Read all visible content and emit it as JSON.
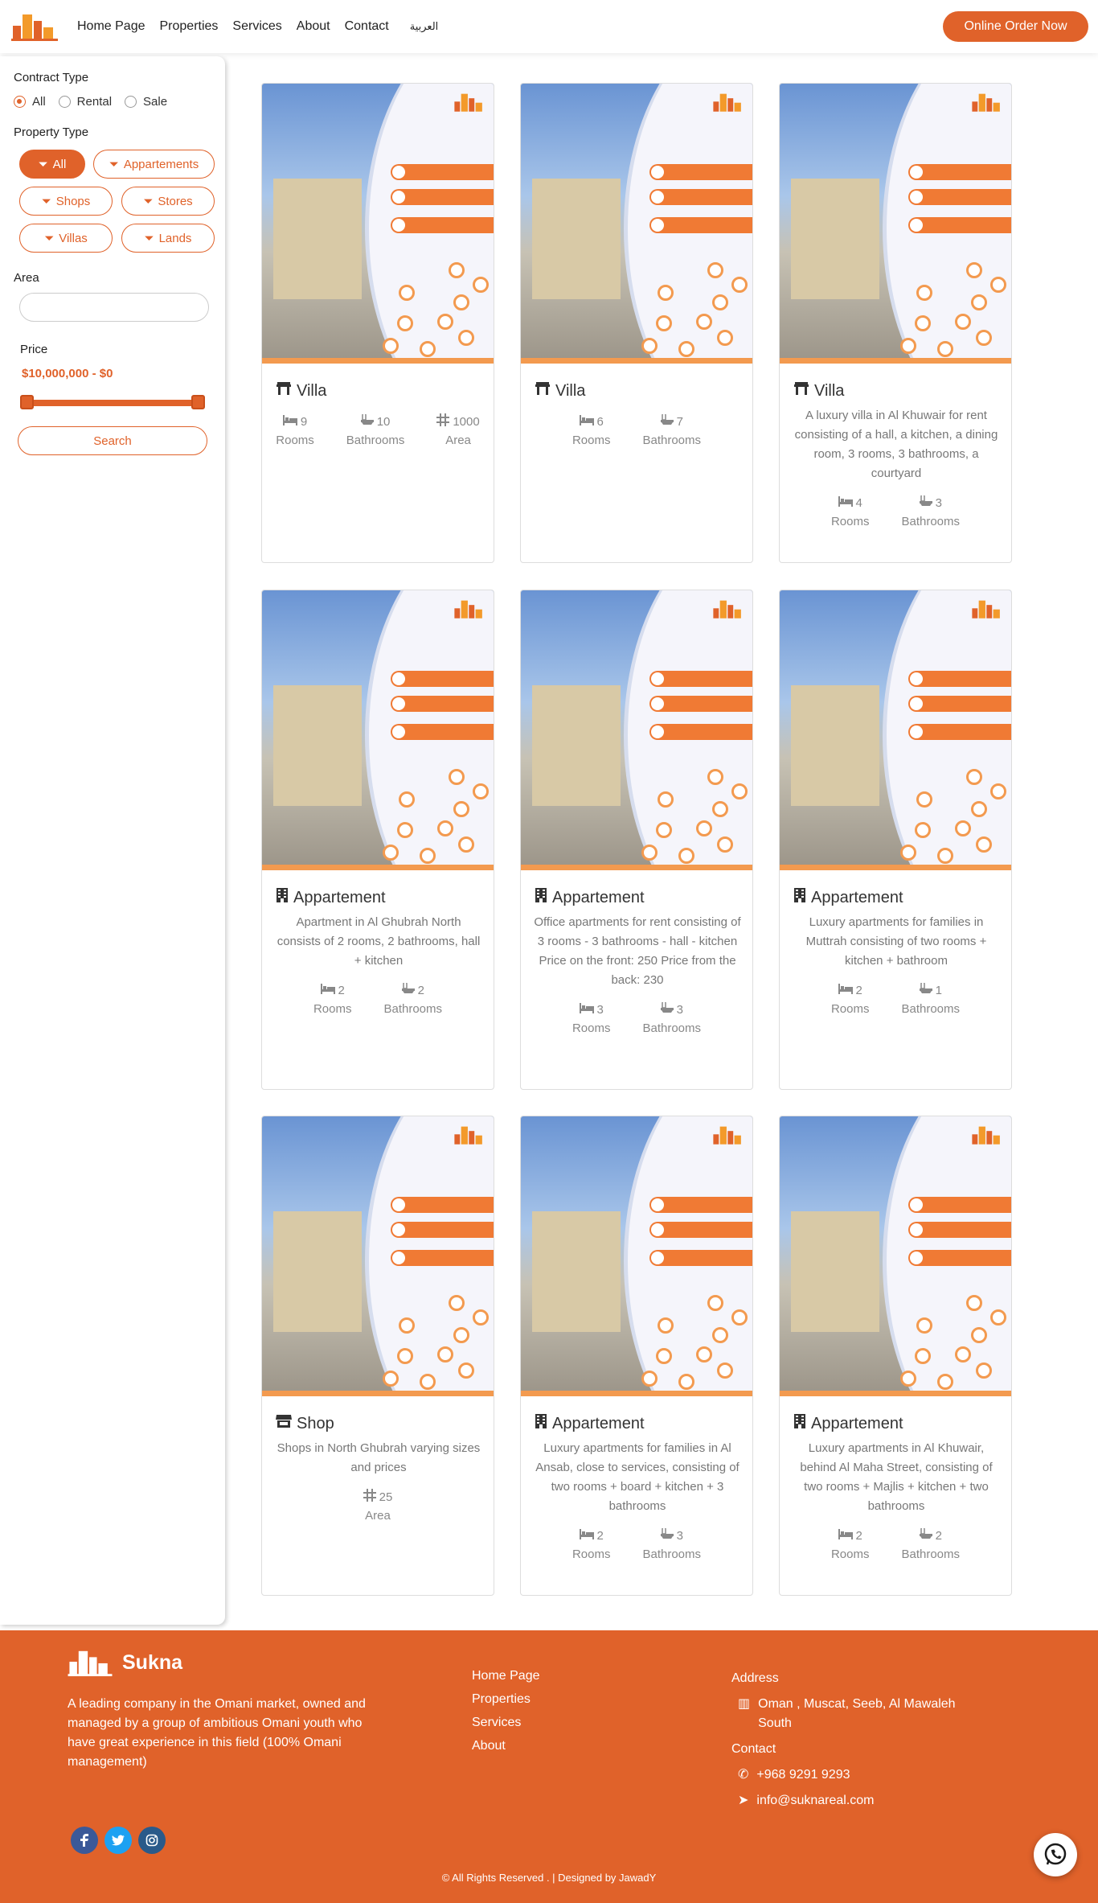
{
  "header": {
    "nav": [
      "Home Page",
      "Properties",
      "Services",
      "About",
      "Contact"
    ],
    "arabic_link": "العربية",
    "order_button": "Online Order Now"
  },
  "sidebar": {
    "contract_type_label": "Contract Type",
    "contract_options": [
      "All",
      "Rental",
      "Sale"
    ],
    "contract_selected": "All",
    "property_type_label": "Property Type",
    "property_types": [
      "All",
      "Appartements",
      "Shops",
      "Stores",
      "Villas",
      "Lands"
    ],
    "property_selected": "All",
    "area_label": "Area",
    "area_value": "",
    "price_label": "Price",
    "price_range": "$10,000,000 - $0",
    "search_button": "Search"
  },
  "cards": [
    {
      "title": "Villa",
      "icon": "villa-icon",
      "description": "",
      "stats": [
        {
          "value": "9",
          "label": "Rooms",
          "icon": "bed-icon"
        },
        {
          "value": "10",
          "label": "Bathrooms",
          "icon": "bath-icon"
        },
        {
          "value": "1000",
          "label": "Area",
          "icon": "area-icon"
        }
      ]
    },
    {
      "title": "Villa",
      "icon": "villa-icon",
      "description": "",
      "stats": [
        {
          "value": "6",
          "label": "Rooms",
          "icon": "bed-icon"
        },
        {
          "value": "7",
          "label": "Bathrooms",
          "icon": "bath-icon"
        }
      ]
    },
    {
      "title": "Villa",
      "icon": "villa-icon",
      "description": "A luxury villa in Al Khuwair for rent consisting of a hall, a kitchen, a dining room, 3 rooms, 3 bathrooms, a courtyard",
      "stats": [
        {
          "value": "4",
          "label": "Rooms",
          "icon": "bed-icon"
        },
        {
          "value": "3",
          "label": "Bathrooms",
          "icon": "bath-icon"
        }
      ]
    },
    {
      "title": "Appartement",
      "icon": "building-icon",
      "description": "Apartment in Al Ghubrah North consists of 2 rooms, 2 bathrooms, hall + kitchen",
      "stats": [
        {
          "value": "2",
          "label": "Rooms",
          "icon": "bed-icon"
        },
        {
          "value": "2",
          "label": "Bathrooms",
          "icon": "bath-icon"
        }
      ]
    },
    {
      "title": "Appartement",
      "icon": "building-icon",
      "description": "Office apartments for rent consisting of 3 rooms - 3 bathrooms - hall - kitchen Price on the front: 250 Price from the back: 230",
      "stats": [
        {
          "value": "3",
          "label": "Rooms",
          "icon": "bed-icon"
        },
        {
          "value": "3",
          "label": "Bathrooms",
          "icon": "bath-icon"
        }
      ]
    },
    {
      "title": "Appartement",
      "icon": "building-icon",
      "description": "Luxury apartments for families in Muttrah consisting of two rooms + kitchen + bathroom",
      "stats": [
        {
          "value": "2",
          "label": "Rooms",
          "icon": "bed-icon"
        },
        {
          "value": "1",
          "label": "Bathrooms",
          "icon": "bath-icon"
        }
      ]
    },
    {
      "title": "Shop",
      "icon": "shop-icon",
      "description": "Shops in North Ghubrah varying sizes and prices",
      "stats": [
        {
          "value": "25",
          "label": "Area",
          "icon": "area-icon"
        }
      ]
    },
    {
      "title": "Appartement",
      "icon": "building-icon",
      "description": "Luxury apartments for families in Al Ansab, close to services, consisting of two rooms + board + kitchen + 3 bathrooms",
      "stats": [
        {
          "value": "2",
          "label": "Rooms",
          "icon": "bed-icon"
        },
        {
          "value": "3",
          "label": "Bathrooms",
          "icon": "bath-icon"
        }
      ]
    },
    {
      "title": "Appartement",
      "icon": "building-icon",
      "description": "Luxury apartments in Al Khuwair, behind Al Maha Street, consisting of two rooms + Majlis + kitchen + two bathrooms",
      "stats": [
        {
          "value": "2",
          "label": "Rooms",
          "icon": "bed-icon"
        },
        {
          "value": "2",
          "label": "Bathrooms",
          "icon": "bath-icon"
        }
      ]
    }
  ],
  "footer": {
    "brand": "Sukna",
    "about": "A leading company in the Omani market, owned and managed by a group of ambitious Omani youth who have great experience in this field (100% Omani management)",
    "links": [
      "Home Page",
      "Properties",
      "Services",
      "About"
    ],
    "address_label": "Address",
    "address": "Oman , Muscat, Seeb, Al Mawaleh South",
    "contact_label": "Contact",
    "phone": "+968 9291 9293",
    "email": "info@suknareal.com",
    "copyright": "© All Rights Reserved . | Designed by JawadY"
  },
  "colors": {
    "accent": "#e0622a",
    "facebook": "#3b5998",
    "twitter": "#1da1f2",
    "instagram": "#2a5a8a"
  }
}
